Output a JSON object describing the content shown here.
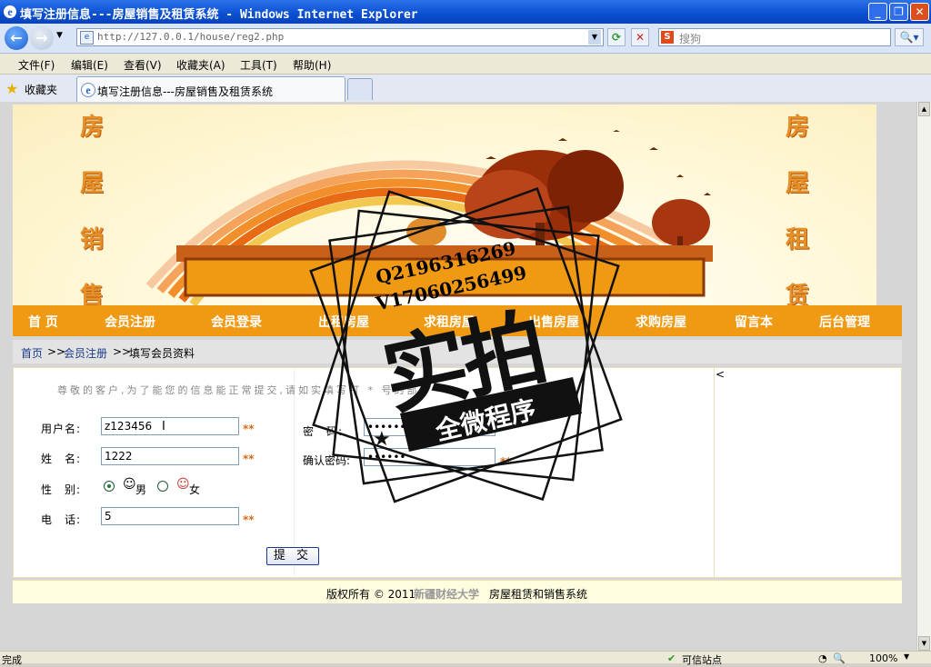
{
  "window": {
    "title": "填写注册信息---房屋销售及租赁系统 - Windows Internet Explorer"
  },
  "browser": {
    "address": "http://127.0.0.1/house/reg2.php",
    "search_placeholder": "搜狗",
    "search_engine_label": "S",
    "menu": [
      "文件(F)",
      "编辑(E)",
      "查看(V)",
      "收藏夹(A)",
      "工具(T)",
      "帮助(H)"
    ],
    "favorites_label": "收藏夹",
    "tab_title": "填写注册信息---房屋销售及租赁系统"
  },
  "banner": {
    "left_chars": [
      "房",
      "屋",
      "销",
      "售"
    ],
    "right_chars": [
      "房",
      "屋",
      "租",
      "赁"
    ]
  },
  "nav": [
    "首 页",
    "会员注册",
    "会员登录",
    "出租房屋",
    "求租房屋",
    "出售房屋",
    "求购房屋",
    "留言本",
    "后台管理"
  ],
  "breadcrumb": {
    "home": "首页",
    "sep": ">>",
    "register": "会员注册",
    "current": "填写会员资料"
  },
  "form": {
    "notice": "尊敬的客户,为了能您的信息能正常提交,请如实填写打 * 号的部分",
    "username_label": "用户名:",
    "username_value": "z123456",
    "realname_label": "姓　名:",
    "realname_value": "1222",
    "gender_label": "性　别:",
    "gender_male": "男",
    "gender_female": "女",
    "phone_label": "电　话:",
    "phone_value": "5",
    "password_label": "密　码:",
    "password_value": "••••••",
    "confirm_label": "确认密码:",
    "confirm_value": "••••••",
    "required_mark": "**",
    "submit": "提 交",
    "side_arrow": "<"
  },
  "footer": {
    "prefix": "版权所有 © 2011",
    "university": "新疆财经大学",
    "suffix": "房屋租赁和销售系统"
  },
  "status": {
    "left": "完成",
    "zone": "可信站点",
    "zoom": "100%"
  },
  "watermark": {
    "line1": "Q2196316269",
    "line2": "V17060256499",
    "main": "实拍",
    "sub": "全微程序"
  },
  "colors": {
    "nav_bg": "#f09a14",
    "title_bar": "#0a4fd1",
    "required": "#d26c1a"
  }
}
